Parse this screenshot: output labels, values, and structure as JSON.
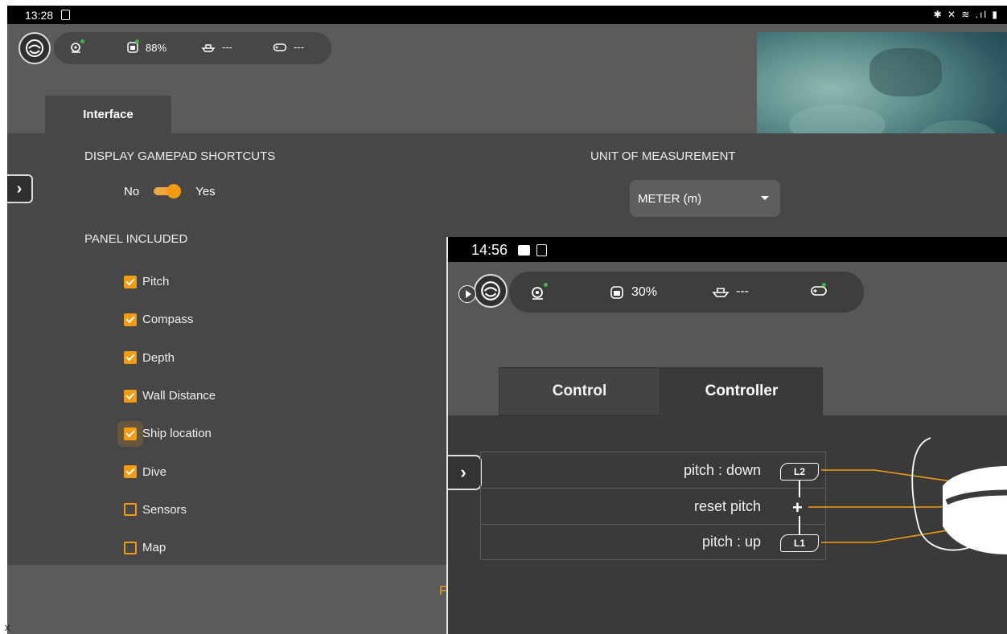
{
  "screen1": {
    "status": {
      "time": "13:28",
      "icons_text": "✱ ✕ ≋ .ıl ▮"
    },
    "topbar": {
      "battery": "88%",
      "ship": "---",
      "gamepad": "---"
    },
    "tabs": {
      "interface": "Interface"
    },
    "gamepad_shortcuts": {
      "title": "DISPLAY GAMEPAD SHORTCUTS",
      "no": "No",
      "yes": "Yes",
      "value": true
    },
    "unit": {
      "title": "UNIT OF MEASUREMENT",
      "selected": "METER (m)"
    },
    "panel": {
      "title": "PANEL INCLUDED",
      "items": [
        {
          "label": "Pitch",
          "checked": true
        },
        {
          "label": "Compass",
          "checked": true
        },
        {
          "label": "Depth",
          "checked": true
        },
        {
          "label": "Wall Distance",
          "checked": true
        },
        {
          "label": "Ship location",
          "checked": true
        },
        {
          "label": "Dive",
          "checked": true
        },
        {
          "label": "Sensors",
          "checked": false
        },
        {
          "label": "Map",
          "checked": false
        }
      ]
    },
    "footer_fragment": "F",
    "corner_x": "x"
  },
  "screen2": {
    "status": {
      "time": "14:56"
    },
    "topbar": {
      "battery": "30%",
      "ship": "---"
    },
    "tabs": {
      "control": "Control",
      "controller": "Controller",
      "active": "Controller"
    },
    "mapping": [
      {
        "action": "pitch : down",
        "button": "L2"
      },
      {
        "action": "reset pitch",
        "button": "+"
      },
      {
        "action": "pitch : up",
        "button": "L1"
      }
    ]
  },
  "colors": {
    "accent": "#f39c12",
    "status_ok": "#4caf50"
  }
}
